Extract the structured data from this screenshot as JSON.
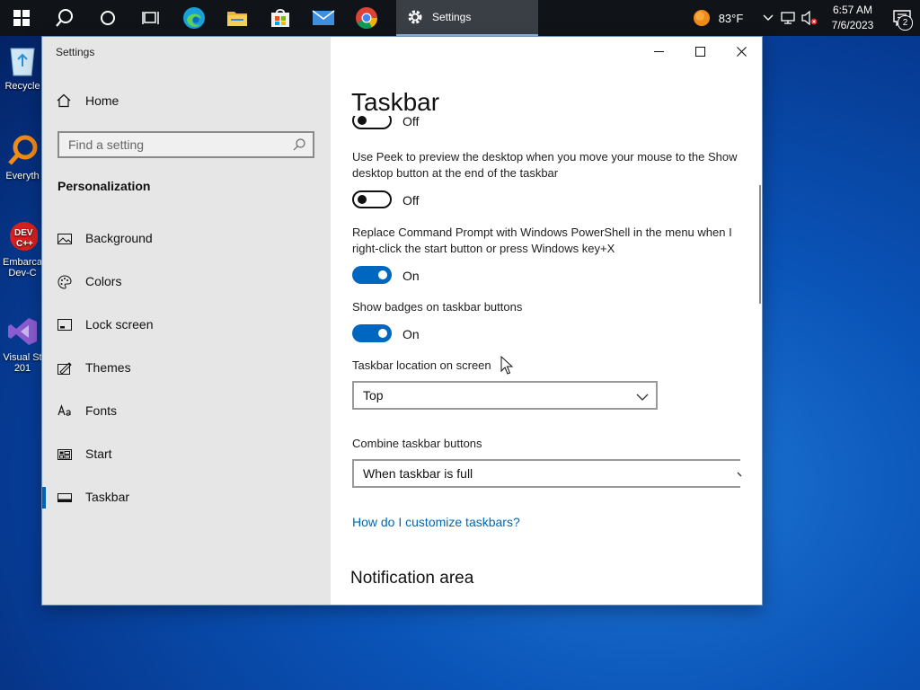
{
  "taskbar": {
    "active_app_label": "Settings",
    "weather": "83°F",
    "time": "6:57 AM",
    "date": "7/6/2023",
    "notification_count": "2"
  },
  "desktop": {
    "icons": [
      {
        "label": "Recycle"
      },
      {
        "label": "Everyth"
      },
      {
        "label": "Embarca Dev-C"
      },
      {
        "label": "Visual St 201"
      }
    ]
  },
  "window": {
    "title": "Settings"
  },
  "sidebar": {
    "home_label": "Home",
    "search_placeholder": "Find a setting",
    "section_title": "Personalization",
    "items": [
      {
        "label": "Background",
        "icon": "image-icon"
      },
      {
        "label": "Colors",
        "icon": "palette-icon"
      },
      {
        "label": "Lock screen",
        "icon": "lock-screen-icon"
      },
      {
        "label": "Themes",
        "icon": "themes-icon"
      },
      {
        "label": "Fonts",
        "icon": "fonts-icon"
      },
      {
        "label": "Start",
        "icon": "start-icon"
      },
      {
        "label": "Taskbar",
        "icon": "taskbar-icon",
        "selected": true
      }
    ]
  },
  "content": {
    "page_title": "Taskbar",
    "top_toggle_state": "Off",
    "peek_text": "Use Peek to preview the desktop when you move your mouse to the Show desktop button at the end of the taskbar",
    "peek_state": "Off",
    "powershell_text": "Replace Command Prompt with Windows PowerShell in the menu when I right-click the start button or press Windows key+X",
    "powershell_state": "On",
    "badges_text": "Show badges on taskbar buttons",
    "badges_state": "On",
    "location_label": "Taskbar location on screen",
    "location_value": "Top",
    "combine_label": "Combine taskbar buttons",
    "combine_value": "When taskbar is full",
    "help_link": "How do I customize taskbars?",
    "notification_heading": "Notification area"
  },
  "colors": {
    "accent": "#0067c0",
    "link": "#0067b8",
    "sidebar_bg": "#e6e6e6",
    "taskbar_bg": "#101418"
  }
}
